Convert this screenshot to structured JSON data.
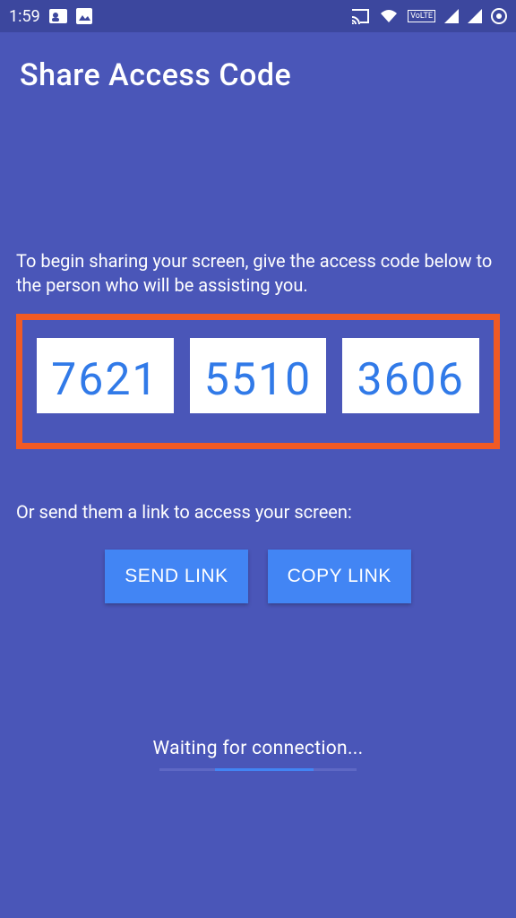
{
  "status": {
    "time": "1:59",
    "volte": "VoLTE"
  },
  "header": {
    "title": "Share Access Code"
  },
  "instructions": {
    "begin": "To begin sharing your screen, give the access code below to the person who will be assisting you.",
    "or_send": "Or send them a link to access your screen:"
  },
  "code": {
    "segments": [
      "7621",
      "5510",
      "3606"
    ]
  },
  "buttons": {
    "send": "SEND LINK",
    "copy": "COPY LINK"
  },
  "waiting": {
    "text": "Waiting for connection..."
  }
}
